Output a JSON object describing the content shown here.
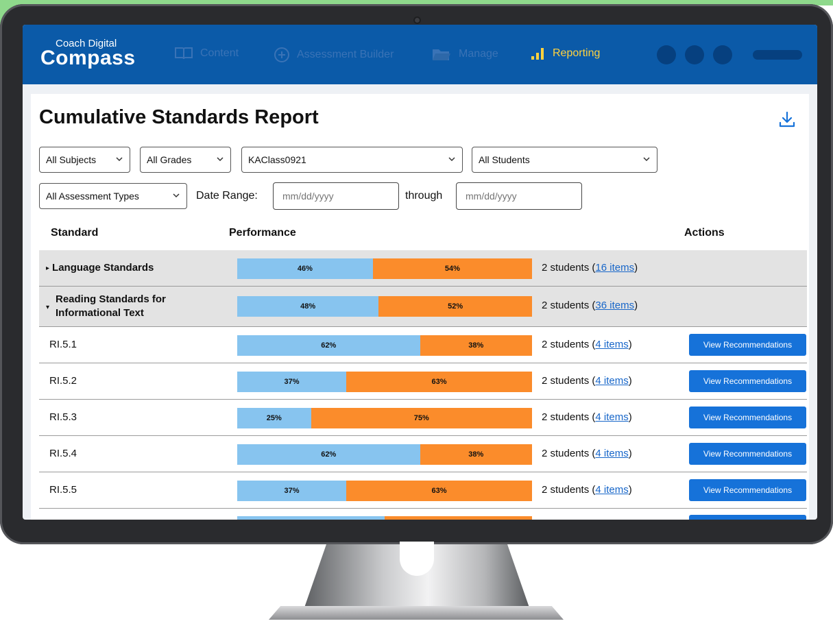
{
  "nav": {
    "logo_small": "Coach Digital",
    "logo_big": "Compass",
    "items": [
      {
        "label": "Content",
        "icon": "book-icon",
        "active": false
      },
      {
        "label": "Assessment Builder",
        "icon": "plus-circle-icon",
        "active": false
      },
      {
        "label": "Manage",
        "icon": "folder-icon",
        "active": false
      },
      {
        "label": "Reporting",
        "icon": "bar-chart-icon",
        "active": true
      }
    ]
  },
  "report": {
    "title": "Cumulative Standards Report",
    "download_icon": "download-icon"
  },
  "filters": {
    "subject": "All Subjects",
    "grade": "All Grades",
    "class": "KAClass0921",
    "students": "All Students",
    "assessment_type": "All Assessment Types",
    "date_range_label": "Date Range:",
    "through_label": "through",
    "date_from_placeholder": "mm/dd/yyyy",
    "date_to_placeholder": "mm/dd/yyyy"
  },
  "table": {
    "columns": {
      "standard": "Standard",
      "performance": "Performance",
      "actions": "Actions"
    },
    "students_text": "2 students (",
    "close_paren": ")",
    "action_label": "View Recommendations",
    "rows": [
      {
        "standard": "Language Standards",
        "group": true,
        "expanded": false,
        "pct_blue": "46%",
        "pct_orange": "54%",
        "blue": 46,
        "orange": 54,
        "items": "16 items"
      },
      {
        "standard": "Reading Standards for Informational Text",
        "group": true,
        "expanded": true,
        "pct_blue": "48%",
        "pct_orange": "52%",
        "blue": 48,
        "orange": 52,
        "items": "36 items"
      },
      {
        "standard": "RI.5.1",
        "group": false,
        "pct_blue": "62%",
        "pct_orange": "38%",
        "blue": 62,
        "orange": 38,
        "items": "4 items"
      },
      {
        "standard": "RI.5.2",
        "group": false,
        "pct_blue": "37%",
        "pct_orange": "63%",
        "blue": 37,
        "orange": 63,
        "items": "4 items"
      },
      {
        "standard": "RI.5.3",
        "group": false,
        "pct_blue": "25%",
        "pct_orange": "75%",
        "blue": 25,
        "orange": 75,
        "items": "4 items"
      },
      {
        "standard": "RI.5.4",
        "group": false,
        "pct_blue": "62%",
        "pct_orange": "38%",
        "blue": 62,
        "orange": 38,
        "items": "4 items"
      },
      {
        "standard": "RI.5.5",
        "group": false,
        "pct_blue": "37%",
        "pct_orange": "63%",
        "blue": 37,
        "orange": 63,
        "items": "4 items"
      }
    ]
  },
  "colors": {
    "nav_bg": "#0b5aa8",
    "active_nav": "#ffd23f",
    "bar_blue": "#87c4ef",
    "bar_orange": "#fb8c2b",
    "button": "#1672d9"
  }
}
